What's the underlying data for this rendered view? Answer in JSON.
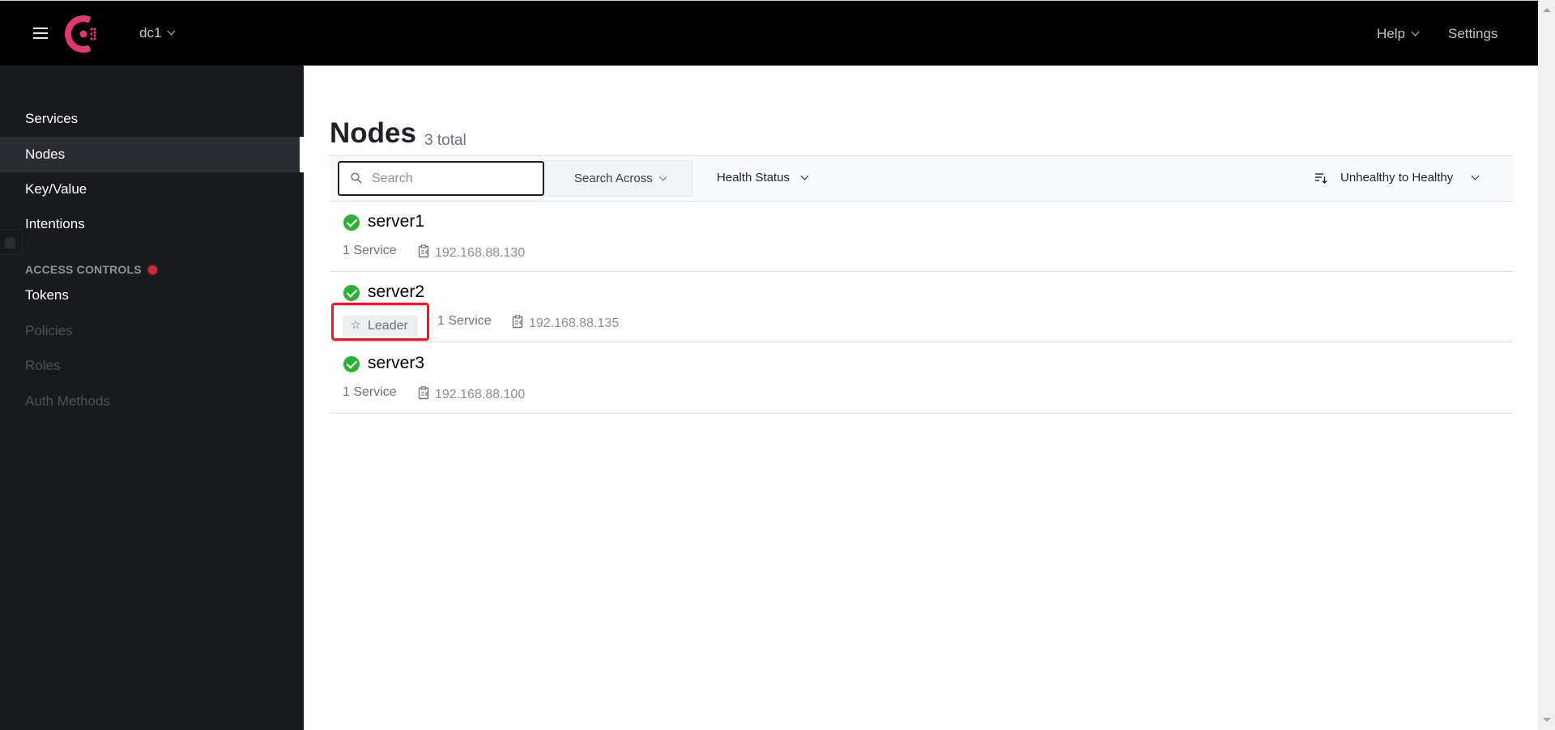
{
  "header": {
    "menu_icon": "hamburger-menu-icon",
    "logo_icon": "consul-logo-icon",
    "datacenter": "dc1",
    "help_label": "Help",
    "settings_label": "Settings",
    "brand_color": "#e03875"
  },
  "sidebar": {
    "items": [
      {
        "label": "Services",
        "state": "normal"
      },
      {
        "label": "Nodes",
        "state": "active"
      },
      {
        "label": "Key/Value",
        "state": "normal"
      },
      {
        "label": "Intentions",
        "state": "normal"
      }
    ],
    "access_controls": {
      "label": "ACCESS CONTROLS",
      "indicator_color": "#cf2c42",
      "items": [
        {
          "label": "Tokens",
          "state": "normal"
        },
        {
          "label": "Policies",
          "state": "disabled"
        },
        {
          "label": "Roles",
          "state": "disabled"
        },
        {
          "label": "Auth Methods",
          "state": "disabled"
        }
      ]
    }
  },
  "main": {
    "title": "Nodes",
    "count": "3 total",
    "search": {
      "placeholder": "Search",
      "value": ""
    },
    "search_across_label": "Search Across",
    "health_status_label": "Health Status",
    "sort_label": "Unhealthy to Healthy",
    "nodes": [
      {
        "name": "server1",
        "status": "passing",
        "leader": false,
        "services": "1 Service",
        "address": "192.168.88.130"
      },
      {
        "name": "server2",
        "status": "passing",
        "leader": true,
        "leader_label": "Leader",
        "services": "1 Service",
        "address": "192.168.88.135"
      },
      {
        "name": "server3",
        "status": "passing",
        "leader": false,
        "services": "1 Service",
        "address": "192.168.88.100"
      }
    ],
    "status_color": "#2eb039"
  },
  "annotation": {
    "target": "leader-badge",
    "color": "#f01a1a"
  }
}
